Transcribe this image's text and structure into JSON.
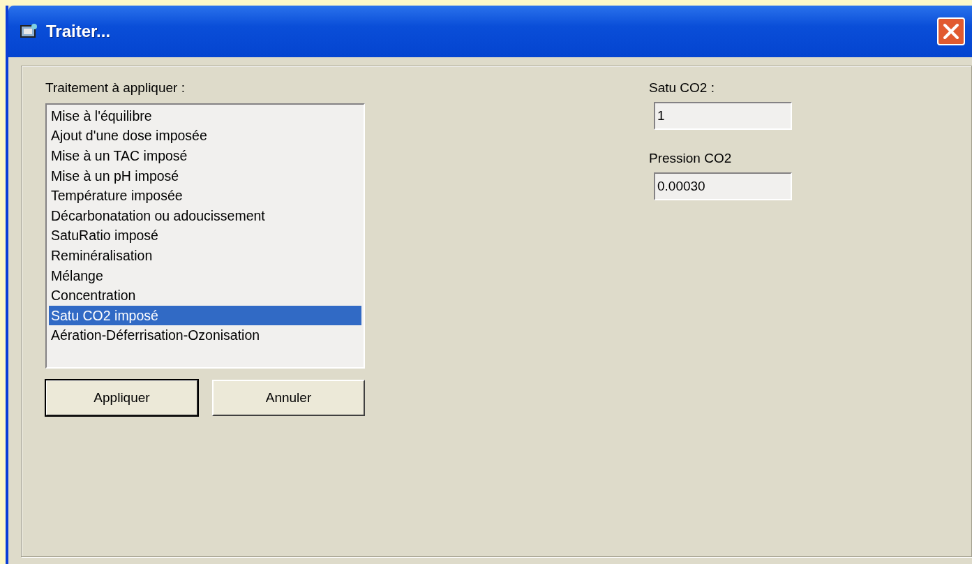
{
  "window": {
    "title": "Traiter..."
  },
  "treatment": {
    "label": "Traitement à appliquer :",
    "items": [
      {
        "label": "Mise à l'équilibre",
        "selected": false
      },
      {
        "label": "Ajout d'une dose imposée",
        "selected": false
      },
      {
        "label": "Mise à un TAC imposé",
        "selected": false
      },
      {
        "label": "Mise à un pH imposé",
        "selected": false
      },
      {
        "label": "Température imposée",
        "selected": false
      },
      {
        "label": "Décarbonatation ou adoucissement",
        "selected": false
      },
      {
        "label": "SatuRatio imposé",
        "selected": false
      },
      {
        "label": "Reminéralisation",
        "selected": false
      },
      {
        "label": "Mélange",
        "selected": false
      },
      {
        "label": "Concentration",
        "selected": false
      },
      {
        "label": "Satu CO2 imposé",
        "selected": true
      },
      {
        "label": "Aération-Déferrisation-Ozonisation",
        "selected": false
      }
    ]
  },
  "buttons": [
    {
      "label": "Appliquer",
      "default": true
    },
    {
      "label": "Annuler",
      "default": false
    }
  ],
  "fields": [
    {
      "label": "Satu CO2 :",
      "value": "1"
    },
    {
      "label": "Pression CO2",
      "value": "0.00030"
    }
  ]
}
